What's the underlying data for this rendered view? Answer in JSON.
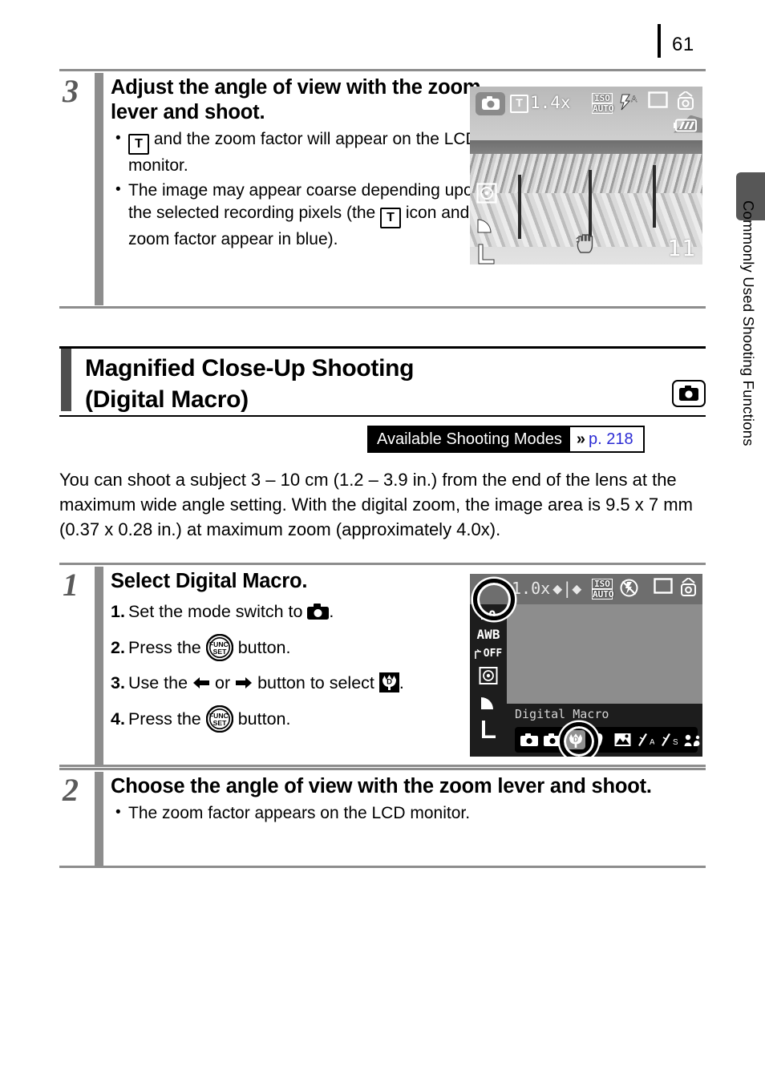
{
  "page": {
    "number": "61",
    "side_tab_label": "Commonly Used Shooting Functions"
  },
  "step3": {
    "number": "3",
    "title": "Adjust the angle of view with the zoom lever and shoot.",
    "bullets": [
      {
        "pre": "",
        "icon": "tele-t-icon",
        "post": " and the zoom factor will appear on the LCD monitor."
      },
      {
        "pre": "The image may appear coarse depending upon the selected recording pixels (the ",
        "icon": "tele-t-icon",
        "post": " icon and the zoom factor appear in blue)."
      }
    ]
  },
  "section": {
    "title_line1": "Magnified Close-Up Shooting",
    "title_line2": "(Digital Macro)",
    "badge_icon": "camera-icon",
    "modes_badge": {
      "label": "Available Shooting Modes",
      "chevron": "»",
      "page_ref": "p. 218",
      "ref_color": "#2b2bd4"
    },
    "body": "You can shoot a subject 3 – 10 cm (1.2 – 3.9 in.) from the end of the lens at the maximum wide angle setting. With the digital zoom, the image area is 9.5 x 7 mm (0.37 x 0.28 in.) at maximum zoom (approximately 4.0x)."
  },
  "step1": {
    "number": "1",
    "title": "Select Digital Macro.",
    "items": [
      {
        "idx": "1.",
        "pre": "Set the mode switch to ",
        "icon": "camera-icon",
        "post": "."
      },
      {
        "idx": "2.",
        "pre": "Press the ",
        "icon": "func-set-icon",
        "post": " button."
      },
      {
        "idx": "3.",
        "pre": "Use the ",
        "icon": "arrow-left-icon",
        "mid": " or ",
        "icon2": "arrow-right-icon",
        "mid2": " button to select ",
        "icon3": "digital-macro-icon",
        "post": "."
      },
      {
        "idx": "4.",
        "pre": "Press the ",
        "icon": "func-set-icon",
        "post": " button."
      }
    ]
  },
  "step2": {
    "number": "2",
    "title": "Choose the angle of view with the zoom lever and shoot.",
    "bullets": [
      {
        "pre": "The zoom factor appears on the LCD monitor.",
        "icon": "",
        "post": ""
      }
    ]
  },
  "lcd_shoot": {
    "mode_icon": "camera-mode-icon",
    "tele_badge": "T",
    "zoom_factor": "1.4x",
    "iso_line1": "ISO",
    "iso_line2": "AUTO",
    "flash_icon": "flash-auto-icon",
    "drive_icon": "single-shot-icon",
    "shake_warn_icon": "camera-shake-icon",
    "battery_icon": "battery-full-icon",
    "metering_icon": "evaluative-metering-icon",
    "compression_icon": "fine-compression-icon",
    "recording_pixels": "L",
    "hand_icon": "hand-shake-icon",
    "shots_remaining": "11"
  },
  "lcd_menu": {
    "selected_mode_icon": "digital-macro-icon",
    "zoom_factor": "1.0x",
    "zoom_bar_icon": "zoom-bar-icon",
    "iso_line1": "ISO",
    "iso_line2": "AUTO",
    "flash_icon": "flash-off-icon",
    "drive_icon": "single-shot-icon",
    "shake_warn_icon": "camera-shake-icon",
    "caption": "Digital Macro",
    "sidebar": [
      {
        "name": "exposure-compensation",
        "label": "±0"
      },
      {
        "name": "white-balance",
        "label": "AWB"
      },
      {
        "name": "my-colors-off",
        "label": "OFF"
      },
      {
        "name": "metering-mode",
        "label": ""
      },
      {
        "name": "compression",
        "label": ""
      },
      {
        "name": "recording-pixels",
        "label": "L"
      }
    ],
    "modes": [
      {
        "name": "auto-mode",
        "label": "",
        "selected": false
      },
      {
        "name": "manual-mode",
        "label": "",
        "selected": false
      },
      {
        "name": "digital-macro-mode",
        "label": "D",
        "selected": true
      },
      {
        "name": "portrait-mode",
        "label": "",
        "selected": false
      },
      {
        "name": "landscape-mode",
        "label": "",
        "selected": false
      },
      {
        "name": "night-snapshot-a-mode",
        "label": "A",
        "selected": false
      },
      {
        "name": "night-snapshot-s-mode",
        "label": "S",
        "selected": false
      },
      {
        "name": "kids-and-pets-mode",
        "label": "",
        "selected": false
      }
    ]
  }
}
